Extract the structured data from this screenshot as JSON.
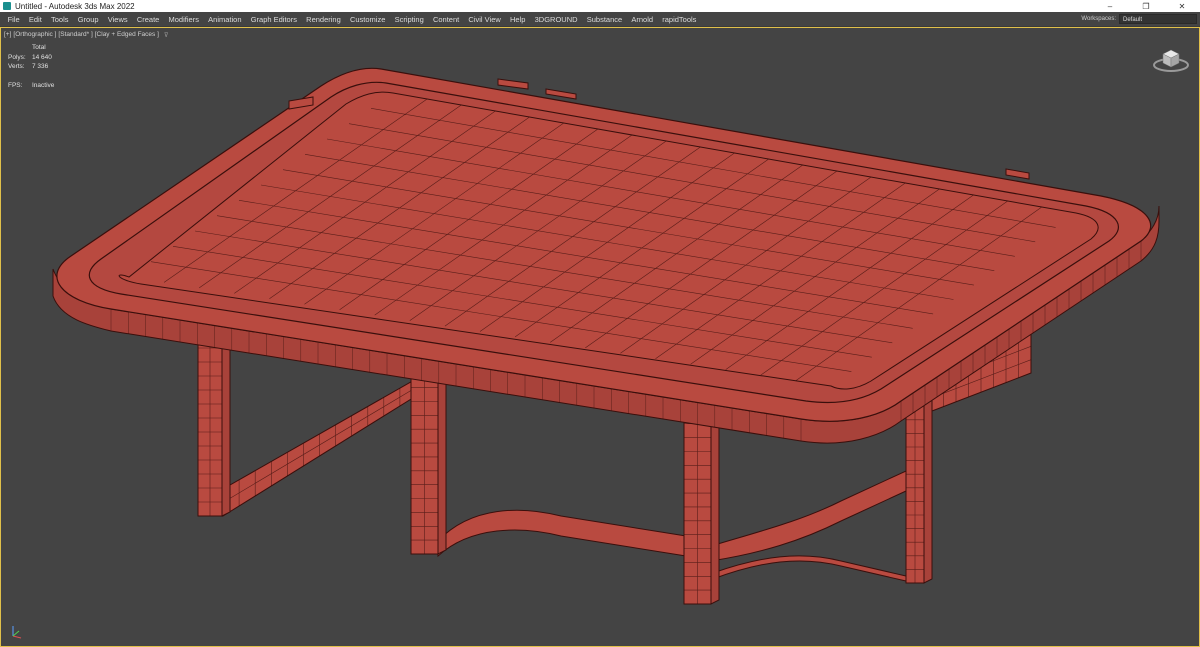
{
  "window": {
    "title": "Untitled - Autodesk 3ds Max 2022",
    "controls": {
      "minimize": "–",
      "maximize": "❐",
      "close": "✕"
    }
  },
  "menu": {
    "items": [
      "File",
      "Edit",
      "Tools",
      "Group",
      "Views",
      "Create",
      "Modifiers",
      "Animation",
      "Graph Editors",
      "Rendering",
      "Customize",
      "Scripting",
      "Content",
      "Civil View",
      "Help",
      "3DGROUND",
      "Substance",
      "Arnold",
      "rapidTools"
    ],
    "workspaces_label": "Workspaces:",
    "workspaces_value": "Default"
  },
  "viewport": {
    "label_plus": "[+]",
    "label_view": "[Orthographic ]",
    "label_shading": "[Standard* ]",
    "label_style": "[Clay + Edged Faces ]",
    "filter_icon": "funnel-icon",
    "stats": {
      "total_label": "Total",
      "polys_label": "Polys:",
      "polys_value": "14 640",
      "verts_label": "Verts:",
      "verts_value": "7 336",
      "fps_label": "FPS:",
      "fps_value": "Inactive"
    },
    "border_color": "#e0c04a",
    "background_color": "#444444",
    "clay_color": "#b94a40",
    "wire_color": "#3a0f0c"
  }
}
